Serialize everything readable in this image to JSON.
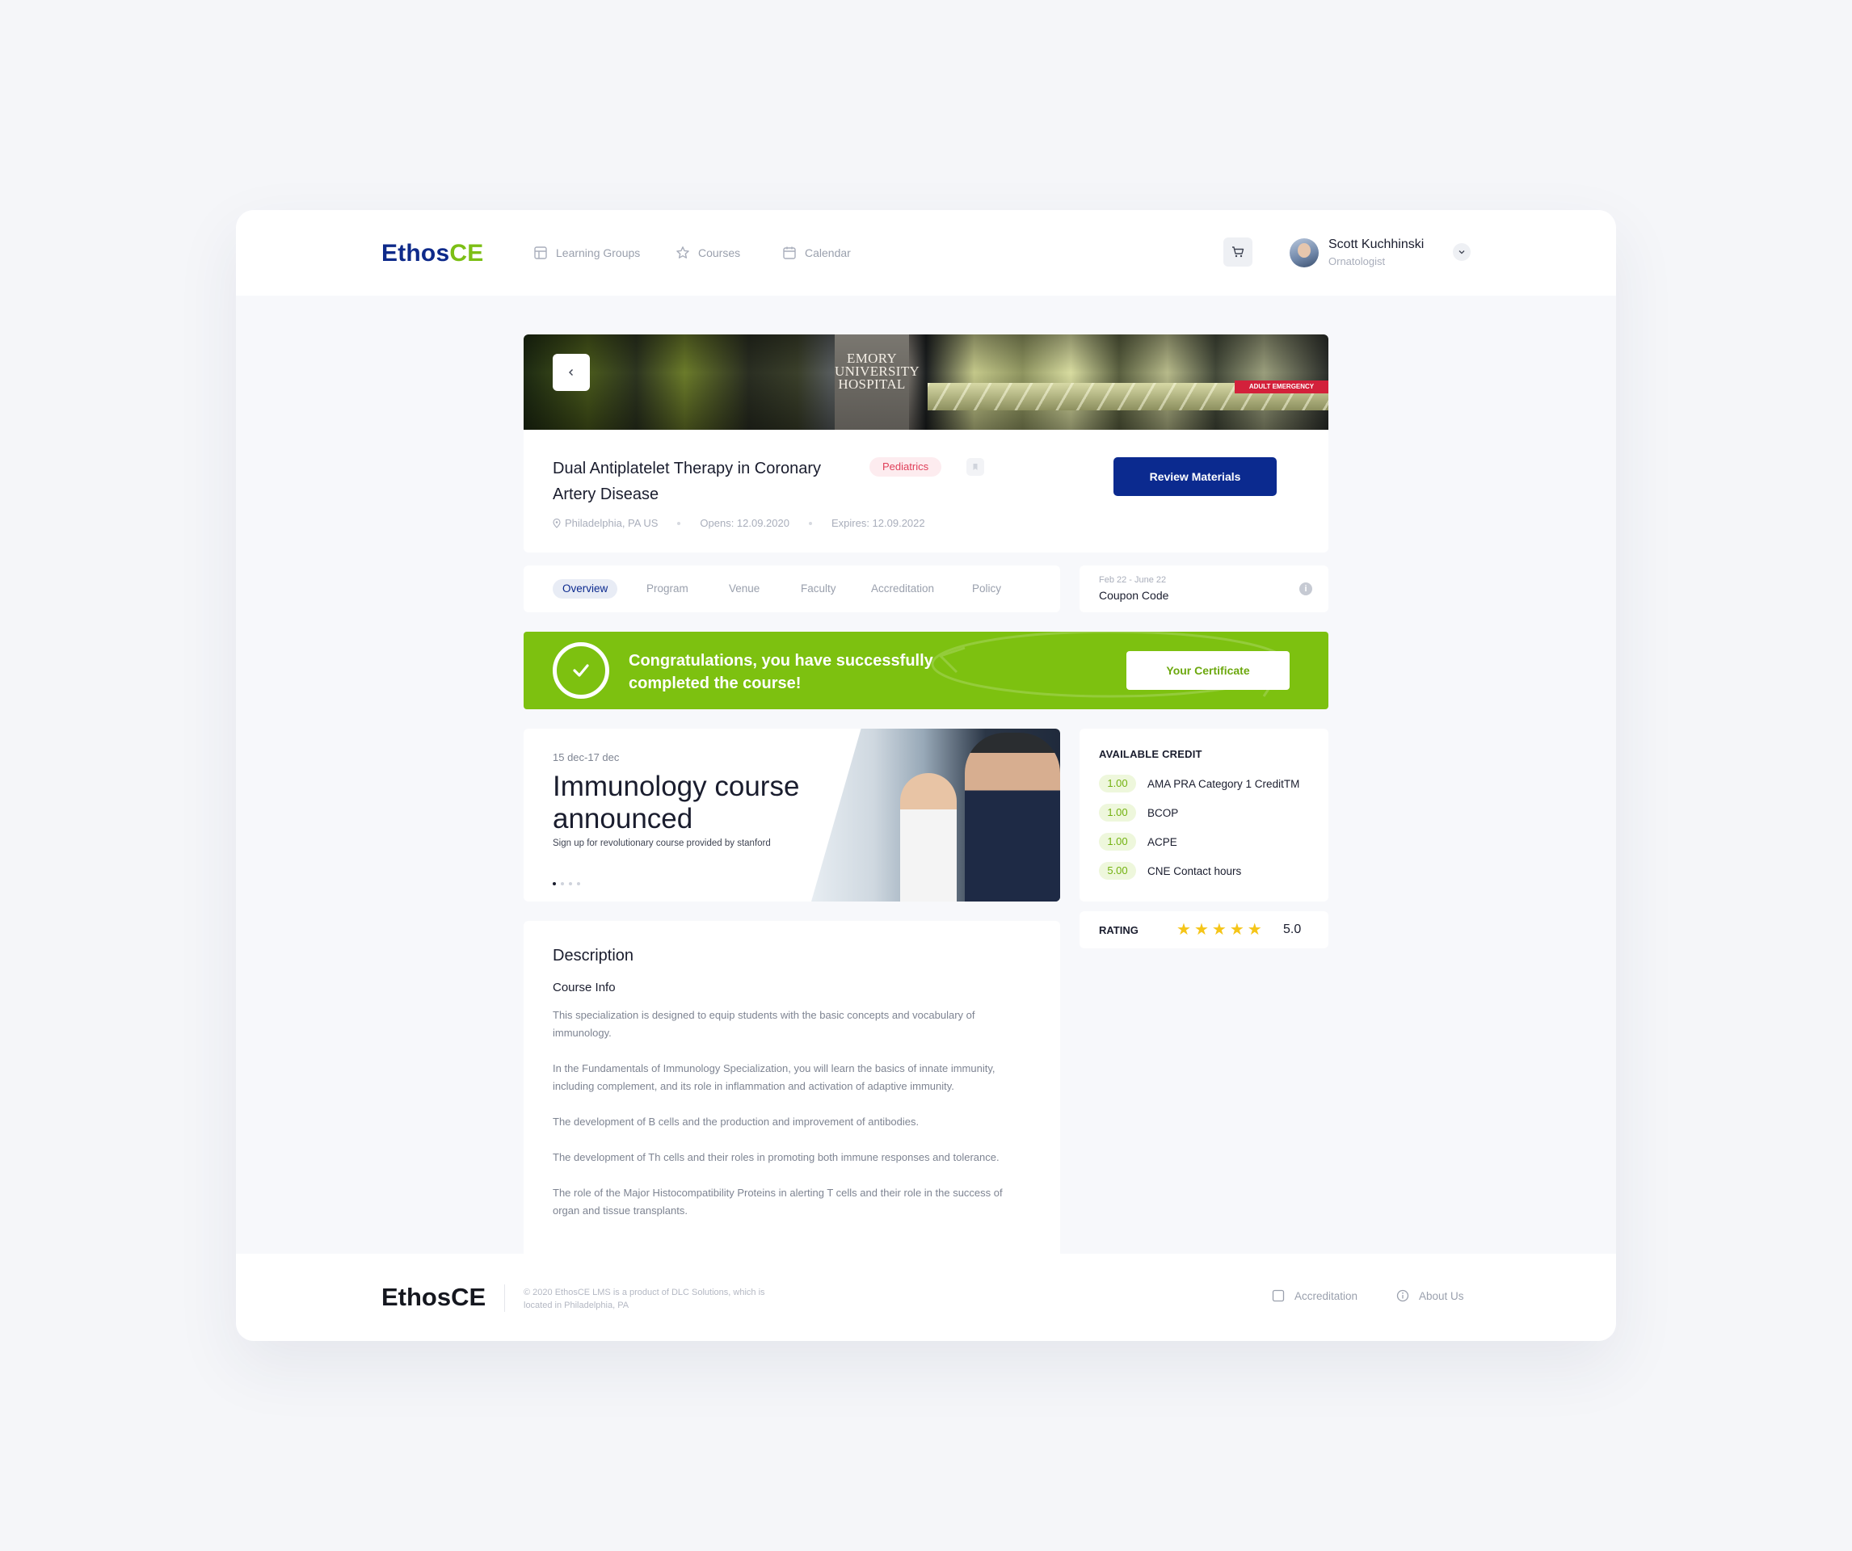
{
  "header": {
    "logo_part1": "Ethos",
    "logo_part2": "CE",
    "nav": [
      {
        "label": "Learning Groups",
        "icon": "layout-icon"
      },
      {
        "label": "Courses",
        "icon": "star-icon"
      },
      {
        "label": "Calendar",
        "icon": "calendar-icon"
      }
    ],
    "user": {
      "name": "Scott Kuchhinski",
      "role": "Ornatologist"
    }
  },
  "hero": {
    "sign_text": "EMORY UNIVERSITY HOSPITAL",
    "er_text": "ADULT EMERGENCY"
  },
  "course": {
    "title": "Dual Antiplatelet Therapy in Coronary Artery Disease",
    "tag": "Pediatrics",
    "location": "Philadelphia, PA US",
    "opens": "Opens: 12.09.2020",
    "expires": "Expires: 12.09.2022",
    "cta": "Review Materials"
  },
  "tabs": [
    "Overview",
    "Program",
    "Venue",
    "Faculty",
    "Accreditation",
    "Policy"
  ],
  "coupon": {
    "dates": "Feb 22 - June 22",
    "label": "Coupon Code"
  },
  "congrats": {
    "text": "Congratulations, you have successfully completed the course!",
    "button": "Your Certificate"
  },
  "promo": {
    "date": "15 dec-17 dec",
    "title": "Immunology course announced",
    "subtitle": "Sign up for revolutionary course provided by stanford",
    "slides": 4,
    "active_slide": 1
  },
  "credit": {
    "heading": "AVAILABLE CREDIT",
    "items": [
      {
        "value": "1.00",
        "name": "AMA PRA Category 1 CreditTM"
      },
      {
        "value": "1.00",
        "name": "BCOP"
      },
      {
        "value": "1.00",
        "name": "ACPE"
      },
      {
        "value": "5.00",
        "name": "CNE Contact hours"
      }
    ]
  },
  "rating": {
    "label": "RATING",
    "stars": 5,
    "value": "5.0"
  },
  "description": {
    "heading": "Description",
    "subheading": "Course Info",
    "paragraphs": [
      "This specialization is designed to equip students with the basic concepts and vocabulary of immunology.",
      "In the Fundamentals of Immunology Specialization, you will learn the basics of innate immunity, including complement, and its role in inflammation and activation of adaptive immunity.",
      "The development of B cells and the production and improvement of antibodies.",
      "The development of Th cells and their roles in promoting both immune responses and tolerance.",
      "The role of the Major Histocompatibility Proteins in alerting T cells and their role in the success of organ and tissue transplants."
    ]
  },
  "footer": {
    "logo": "EthosCE",
    "copyright": "© 2020 EthosCE LMS is a product of DLC Solutions, which is located in Philadelphia, PA",
    "links": [
      {
        "label": "Accreditation",
        "icon": "checkbox-icon"
      },
      {
        "label": "About Us",
        "icon": "info-icon"
      }
    ]
  },
  "colors": {
    "brand_blue": "#0b2a8f",
    "brand_green": "#7dc110",
    "tag_red": "#e0405a"
  }
}
